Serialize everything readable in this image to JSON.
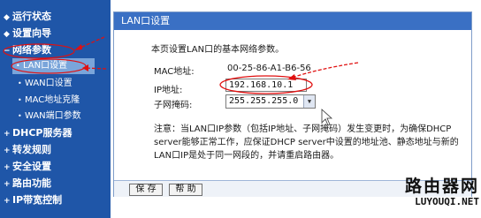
{
  "sidebar": {
    "items": [
      {
        "label": "运行状态",
        "level": "top"
      },
      {
        "label": "设置向导",
        "level": "top"
      },
      {
        "label": "网络参数",
        "level": "top",
        "expanded": true
      },
      {
        "label": "LAN口设置",
        "level": "sub",
        "selected": true
      },
      {
        "label": "WAN口设置",
        "level": "sub"
      },
      {
        "label": "MAC地址克隆",
        "level": "sub"
      },
      {
        "label": "WAN端口参数",
        "level": "sub"
      },
      {
        "label": "DHCP服务器",
        "level": "top"
      },
      {
        "label": "转发规则",
        "level": "top"
      },
      {
        "label": "安全设置",
        "level": "top"
      },
      {
        "label": "路由功能",
        "level": "top"
      },
      {
        "label": "IP带宽控制",
        "level": "top"
      }
    ],
    "background_color": "#1f56a8",
    "selected_color": "#7aa5da"
  },
  "panel": {
    "title": "LAN口设置",
    "intro": "本页设置LAN口的基本网络参数。",
    "mac_label": "MAC地址:",
    "mac_value": "00-25-86-A1-B6-56",
    "ip_label": "IP地址:",
    "ip_value": "192.168.10.1",
    "mask_label": "子网掩码:",
    "mask_value": "255.255.255.0",
    "note": "注意：当LAN口IP参数（包括IP地址、子网掩码）发生变更时，为确保DHCP server能够正常工作，应保证DHCP server中设置的地址池、静态地址与新的LAN口IP是处于同一网段的，并请重启路由器。",
    "save_label": "保 存",
    "help_label": "帮 助",
    "title_color": "#3a70c4"
  },
  "annotations": {
    "color": "#e01010"
  },
  "watermark": {
    "main": "路由器网",
    "sub": "LUYOUQI.NET"
  }
}
